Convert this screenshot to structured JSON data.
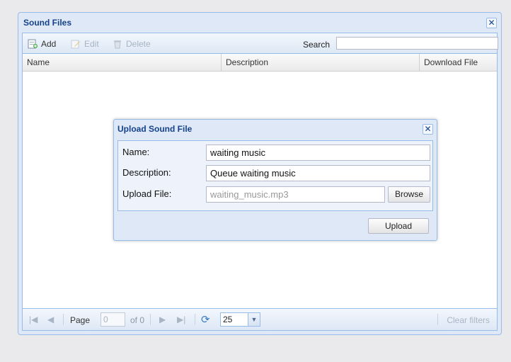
{
  "window": {
    "title": "Sound Files",
    "close_glyph": "✕"
  },
  "toolbar": {
    "add_label": "Add",
    "edit_label": "Edit",
    "delete_label": "Delete",
    "search_label": "Search",
    "search_value": ""
  },
  "grid": {
    "columns": [
      "Name",
      "Description",
      "Download File"
    ]
  },
  "pager": {
    "page_label": "Page",
    "page_value": "0",
    "of_label": "of 0",
    "page_size": "25",
    "clear_filters_label": "Clear filters"
  },
  "dialog": {
    "title": "Upload Sound File",
    "close_glyph": "✕",
    "fields": {
      "name_label": "Name:",
      "name_value": "waiting music",
      "description_label": "Description:",
      "description_value": "Queue waiting music",
      "upload_label": "Upload File:",
      "upload_value": "waiting_music.mp3"
    },
    "browse_label": "Browse",
    "upload_label": "Upload"
  },
  "colors": {
    "panel_bg": "#dfe8f6",
    "border": "#99bbe8",
    "title_text": "#15428b"
  },
  "icons": [
    "add-icon",
    "edit-icon",
    "delete-icon",
    "first-page-icon",
    "prev-page-icon",
    "next-page-icon",
    "last-page-icon",
    "refresh-icon",
    "chevron-down-icon",
    "close-icon"
  ]
}
